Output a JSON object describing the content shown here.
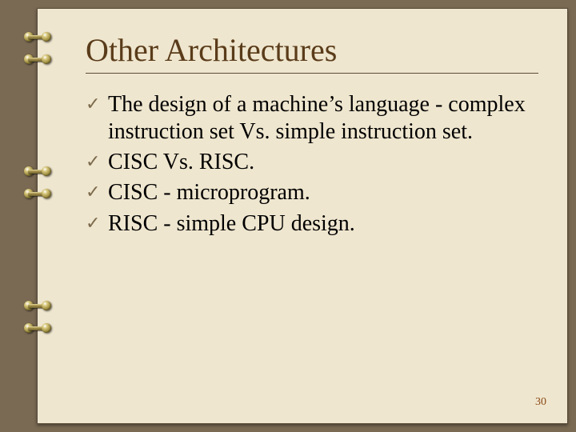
{
  "title": "Other Architectures",
  "bullets": [
    "The design of a machine’s language - complex instruction set Vs. simple instruction set.",
    "CISC Vs. RISC.",
    "CISC - microprogram.",
    "RISC - simple CPU design."
  ],
  "page_number": "30"
}
